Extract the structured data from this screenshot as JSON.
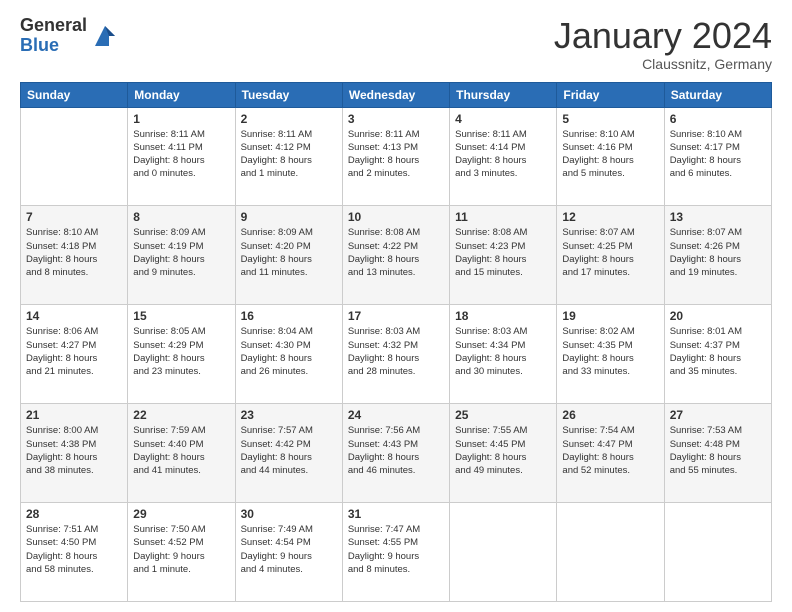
{
  "logo": {
    "general": "General",
    "blue": "Blue"
  },
  "header": {
    "month": "January 2024",
    "location": "Claussnitz, Germany"
  },
  "days_of_week": [
    "Sunday",
    "Monday",
    "Tuesday",
    "Wednesday",
    "Thursday",
    "Friday",
    "Saturday"
  ],
  "weeks": [
    [
      {
        "day": "",
        "info": ""
      },
      {
        "day": "1",
        "info": "Sunrise: 8:11 AM\nSunset: 4:11 PM\nDaylight: 8 hours\nand 0 minutes."
      },
      {
        "day": "2",
        "info": "Sunrise: 8:11 AM\nSunset: 4:12 PM\nDaylight: 8 hours\nand 1 minute."
      },
      {
        "day": "3",
        "info": "Sunrise: 8:11 AM\nSunset: 4:13 PM\nDaylight: 8 hours\nand 2 minutes."
      },
      {
        "day": "4",
        "info": "Sunrise: 8:11 AM\nSunset: 4:14 PM\nDaylight: 8 hours\nand 3 minutes."
      },
      {
        "day": "5",
        "info": "Sunrise: 8:10 AM\nSunset: 4:16 PM\nDaylight: 8 hours\nand 5 minutes."
      },
      {
        "day": "6",
        "info": "Sunrise: 8:10 AM\nSunset: 4:17 PM\nDaylight: 8 hours\nand 6 minutes."
      }
    ],
    [
      {
        "day": "7",
        "info": "Sunrise: 8:10 AM\nSunset: 4:18 PM\nDaylight: 8 hours\nand 8 minutes."
      },
      {
        "day": "8",
        "info": "Sunrise: 8:09 AM\nSunset: 4:19 PM\nDaylight: 8 hours\nand 9 minutes."
      },
      {
        "day": "9",
        "info": "Sunrise: 8:09 AM\nSunset: 4:20 PM\nDaylight: 8 hours\nand 11 minutes."
      },
      {
        "day": "10",
        "info": "Sunrise: 8:08 AM\nSunset: 4:22 PM\nDaylight: 8 hours\nand 13 minutes."
      },
      {
        "day": "11",
        "info": "Sunrise: 8:08 AM\nSunset: 4:23 PM\nDaylight: 8 hours\nand 15 minutes."
      },
      {
        "day": "12",
        "info": "Sunrise: 8:07 AM\nSunset: 4:25 PM\nDaylight: 8 hours\nand 17 minutes."
      },
      {
        "day": "13",
        "info": "Sunrise: 8:07 AM\nSunset: 4:26 PM\nDaylight: 8 hours\nand 19 minutes."
      }
    ],
    [
      {
        "day": "14",
        "info": "Sunrise: 8:06 AM\nSunset: 4:27 PM\nDaylight: 8 hours\nand 21 minutes."
      },
      {
        "day": "15",
        "info": "Sunrise: 8:05 AM\nSunset: 4:29 PM\nDaylight: 8 hours\nand 23 minutes."
      },
      {
        "day": "16",
        "info": "Sunrise: 8:04 AM\nSunset: 4:30 PM\nDaylight: 8 hours\nand 26 minutes."
      },
      {
        "day": "17",
        "info": "Sunrise: 8:03 AM\nSunset: 4:32 PM\nDaylight: 8 hours\nand 28 minutes."
      },
      {
        "day": "18",
        "info": "Sunrise: 8:03 AM\nSunset: 4:34 PM\nDaylight: 8 hours\nand 30 minutes."
      },
      {
        "day": "19",
        "info": "Sunrise: 8:02 AM\nSunset: 4:35 PM\nDaylight: 8 hours\nand 33 minutes."
      },
      {
        "day": "20",
        "info": "Sunrise: 8:01 AM\nSunset: 4:37 PM\nDaylight: 8 hours\nand 35 minutes."
      }
    ],
    [
      {
        "day": "21",
        "info": "Sunrise: 8:00 AM\nSunset: 4:38 PM\nDaylight: 8 hours\nand 38 minutes."
      },
      {
        "day": "22",
        "info": "Sunrise: 7:59 AM\nSunset: 4:40 PM\nDaylight: 8 hours\nand 41 minutes."
      },
      {
        "day": "23",
        "info": "Sunrise: 7:57 AM\nSunset: 4:42 PM\nDaylight: 8 hours\nand 44 minutes."
      },
      {
        "day": "24",
        "info": "Sunrise: 7:56 AM\nSunset: 4:43 PM\nDaylight: 8 hours\nand 46 minutes."
      },
      {
        "day": "25",
        "info": "Sunrise: 7:55 AM\nSunset: 4:45 PM\nDaylight: 8 hours\nand 49 minutes."
      },
      {
        "day": "26",
        "info": "Sunrise: 7:54 AM\nSunset: 4:47 PM\nDaylight: 8 hours\nand 52 minutes."
      },
      {
        "day": "27",
        "info": "Sunrise: 7:53 AM\nSunset: 4:48 PM\nDaylight: 8 hours\nand 55 minutes."
      }
    ],
    [
      {
        "day": "28",
        "info": "Sunrise: 7:51 AM\nSunset: 4:50 PM\nDaylight: 8 hours\nand 58 minutes."
      },
      {
        "day": "29",
        "info": "Sunrise: 7:50 AM\nSunset: 4:52 PM\nDaylight: 9 hours\nand 1 minute."
      },
      {
        "day": "30",
        "info": "Sunrise: 7:49 AM\nSunset: 4:54 PM\nDaylight: 9 hours\nand 4 minutes."
      },
      {
        "day": "31",
        "info": "Sunrise: 7:47 AM\nSunset: 4:55 PM\nDaylight: 9 hours\nand 8 minutes."
      },
      {
        "day": "",
        "info": ""
      },
      {
        "day": "",
        "info": ""
      },
      {
        "day": "",
        "info": ""
      }
    ]
  ]
}
